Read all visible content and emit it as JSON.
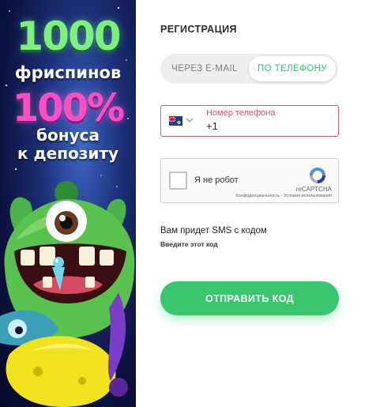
{
  "banner": {
    "line1": "1000",
    "line2": "фриспинов",
    "line3": "100%",
    "line4": "бонуса",
    "line5": "к депозиту"
  },
  "form": {
    "title": "РЕГИСТРАЦИЯ",
    "tabs": {
      "email_label": "ЧЕРЕЗ E-MAIL",
      "phone_label": "ПО ТЕЛЕФОНУ",
      "active": "phone"
    },
    "phone": {
      "label": "Номер телефона",
      "value": "+1"
    },
    "captcha": {
      "label": "Я не робот",
      "brand": "reCAPTCHA",
      "links": "Конфиденциальность - Условия использования"
    },
    "sms_text": "Вам придет SMS с кодом",
    "sms_hint": "Введите этот код",
    "submit_label": "ОТПРАВИТЬ КОД"
  },
  "colors": {
    "accent_green": "#3ac66f",
    "active_tab_text": "#2ec869",
    "error_red": "#e05565"
  }
}
